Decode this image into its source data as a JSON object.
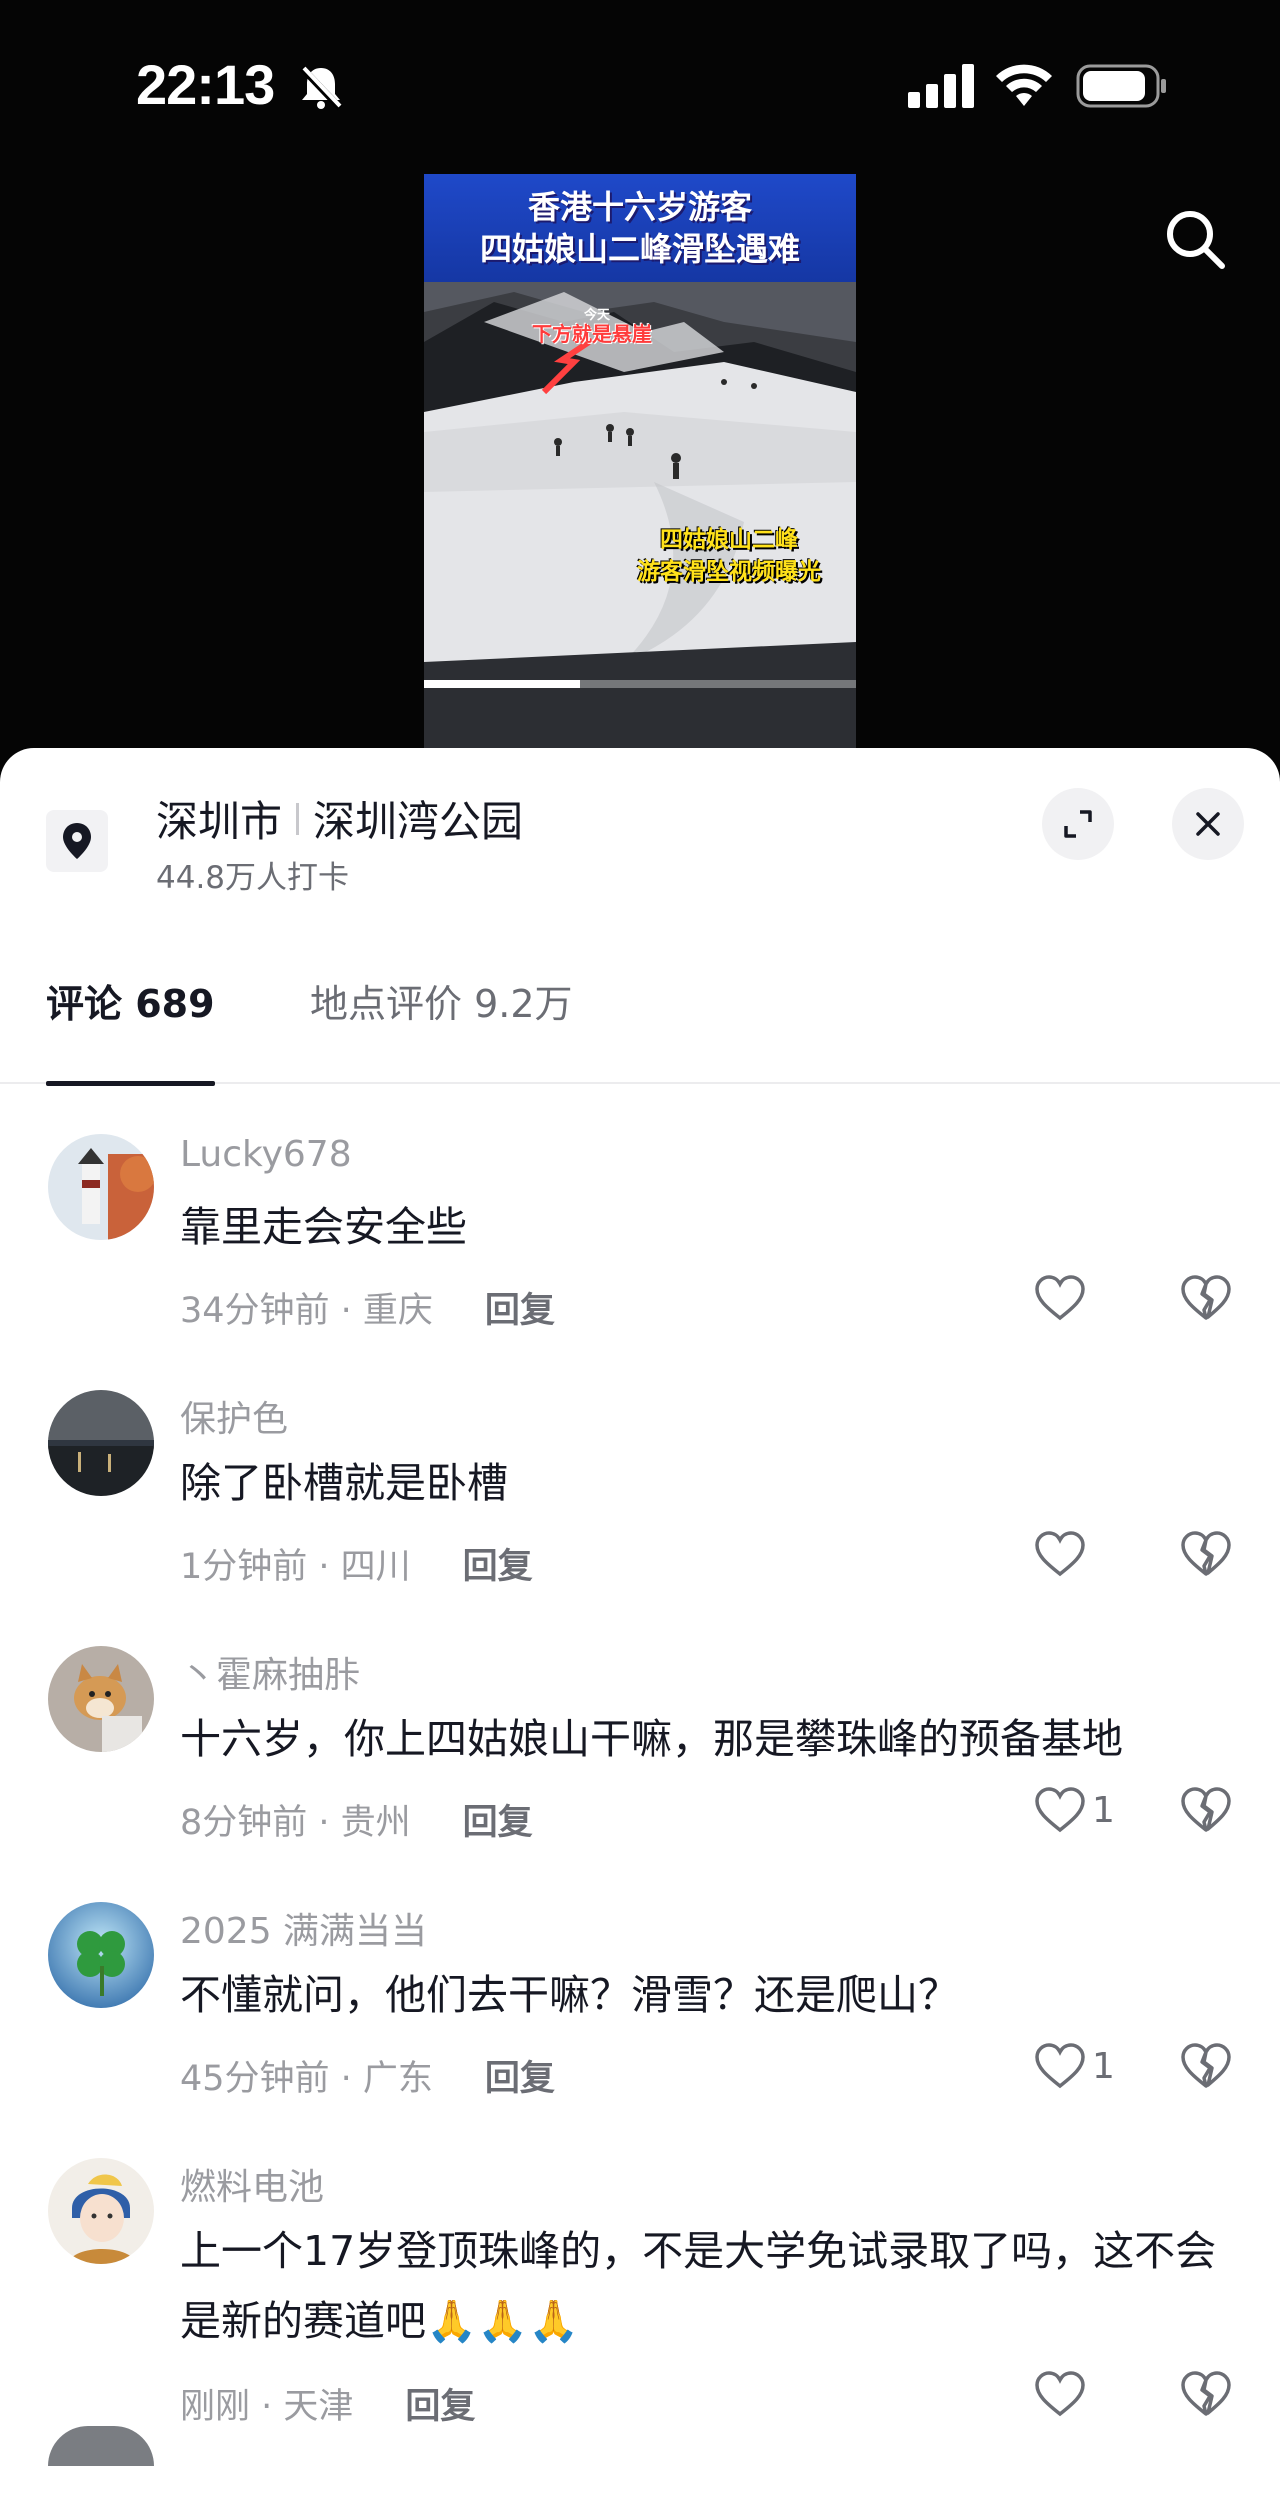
{
  "status_bar": {
    "time": "22:13"
  },
  "video": {
    "banner_line1": "香港十六岁游客",
    "banner_line2": "四姑娘山二峰滑坠遇难",
    "overlay_small": "今天",
    "overlay_warning": "下方就是悬崖",
    "overlay_caption_line1": "四姑娘山二峰",
    "overlay_caption_line2": "游客滑坠视频曝光",
    "progress": 0.36
  },
  "location": {
    "city": "深圳市",
    "place": "深圳湾公园",
    "checkins": "44.8万人打卡"
  },
  "tabs": [
    {
      "label": "评论 689"
    },
    {
      "label": "地点评价 9.2万"
    }
  ],
  "comments": [
    {
      "user": "Lucky678",
      "text": "靠里走会安全些",
      "meta": "34分钟前 · 重庆",
      "reply": "回复",
      "likes": ""
    },
    {
      "user": "保护色",
      "text": "除了卧槽就是卧槽",
      "meta": "1分钟前 · 四川",
      "reply": "回复",
      "likes": ""
    },
    {
      "user": "丶霍麻抽胩",
      "text": "十六岁，你上四姑娘山干嘛，那是攀珠峰的预备基地",
      "meta": "8分钟前 · 贵州",
      "reply": "回复",
      "likes": "1"
    },
    {
      "user": "2025 满满当当",
      "text": "不懂就问，他们去干嘛？滑雪？还是爬山？",
      "meta": "45分钟前 · 广东",
      "reply": "回复",
      "likes": "1"
    },
    {
      "user": "燃料电池",
      "text": "上一个17岁登顶珠峰的，不是大学免试录取了吗，这不会是新的赛道吧🙏🙏🙏",
      "meta": "刚刚 · 天津",
      "reply": "回复",
      "likes": ""
    }
  ]
}
